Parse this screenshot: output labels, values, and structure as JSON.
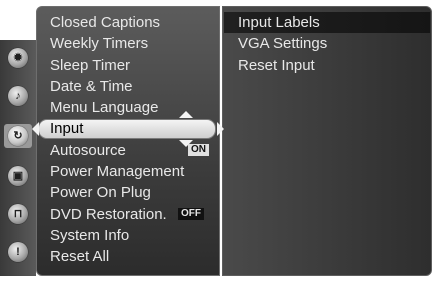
{
  "menu": {
    "items": [
      {
        "label": "Closed Captions"
      },
      {
        "label": "Weekly Timers"
      },
      {
        "label": "Sleep Timer"
      },
      {
        "label": "Date & Time"
      },
      {
        "label": "Menu Language"
      },
      {
        "label": "Input",
        "selected": true
      },
      {
        "label": "Autosource",
        "badge": "ON"
      },
      {
        "label": "Power Management"
      },
      {
        "label": "Power On Plug"
      },
      {
        "label": "DVD Restoration.",
        "badge": "OFF"
      },
      {
        "label": "System Info"
      },
      {
        "label": "Reset All"
      }
    ]
  },
  "submenu": {
    "items": [
      {
        "label": "Input Labels"
      },
      {
        "label": "VGA Settings"
      },
      {
        "label": "Reset Input"
      }
    ]
  },
  "icons": [
    {
      "name": "settings-gear-icon",
      "glyph": "✹"
    },
    {
      "name": "audio-icon",
      "glyph": "♪"
    },
    {
      "name": "setup-icon",
      "glyph": "↻",
      "selected": true
    },
    {
      "name": "tv-icon",
      "glyph": "▣"
    },
    {
      "name": "lock-icon",
      "glyph": "⊓"
    },
    {
      "name": "help-icon",
      "glyph": "!"
    }
  ],
  "colors": {
    "menu_text": "#e8e8e8",
    "selection_bar": "#e6e6e6",
    "panel_bg": "#3c3c3c"
  }
}
